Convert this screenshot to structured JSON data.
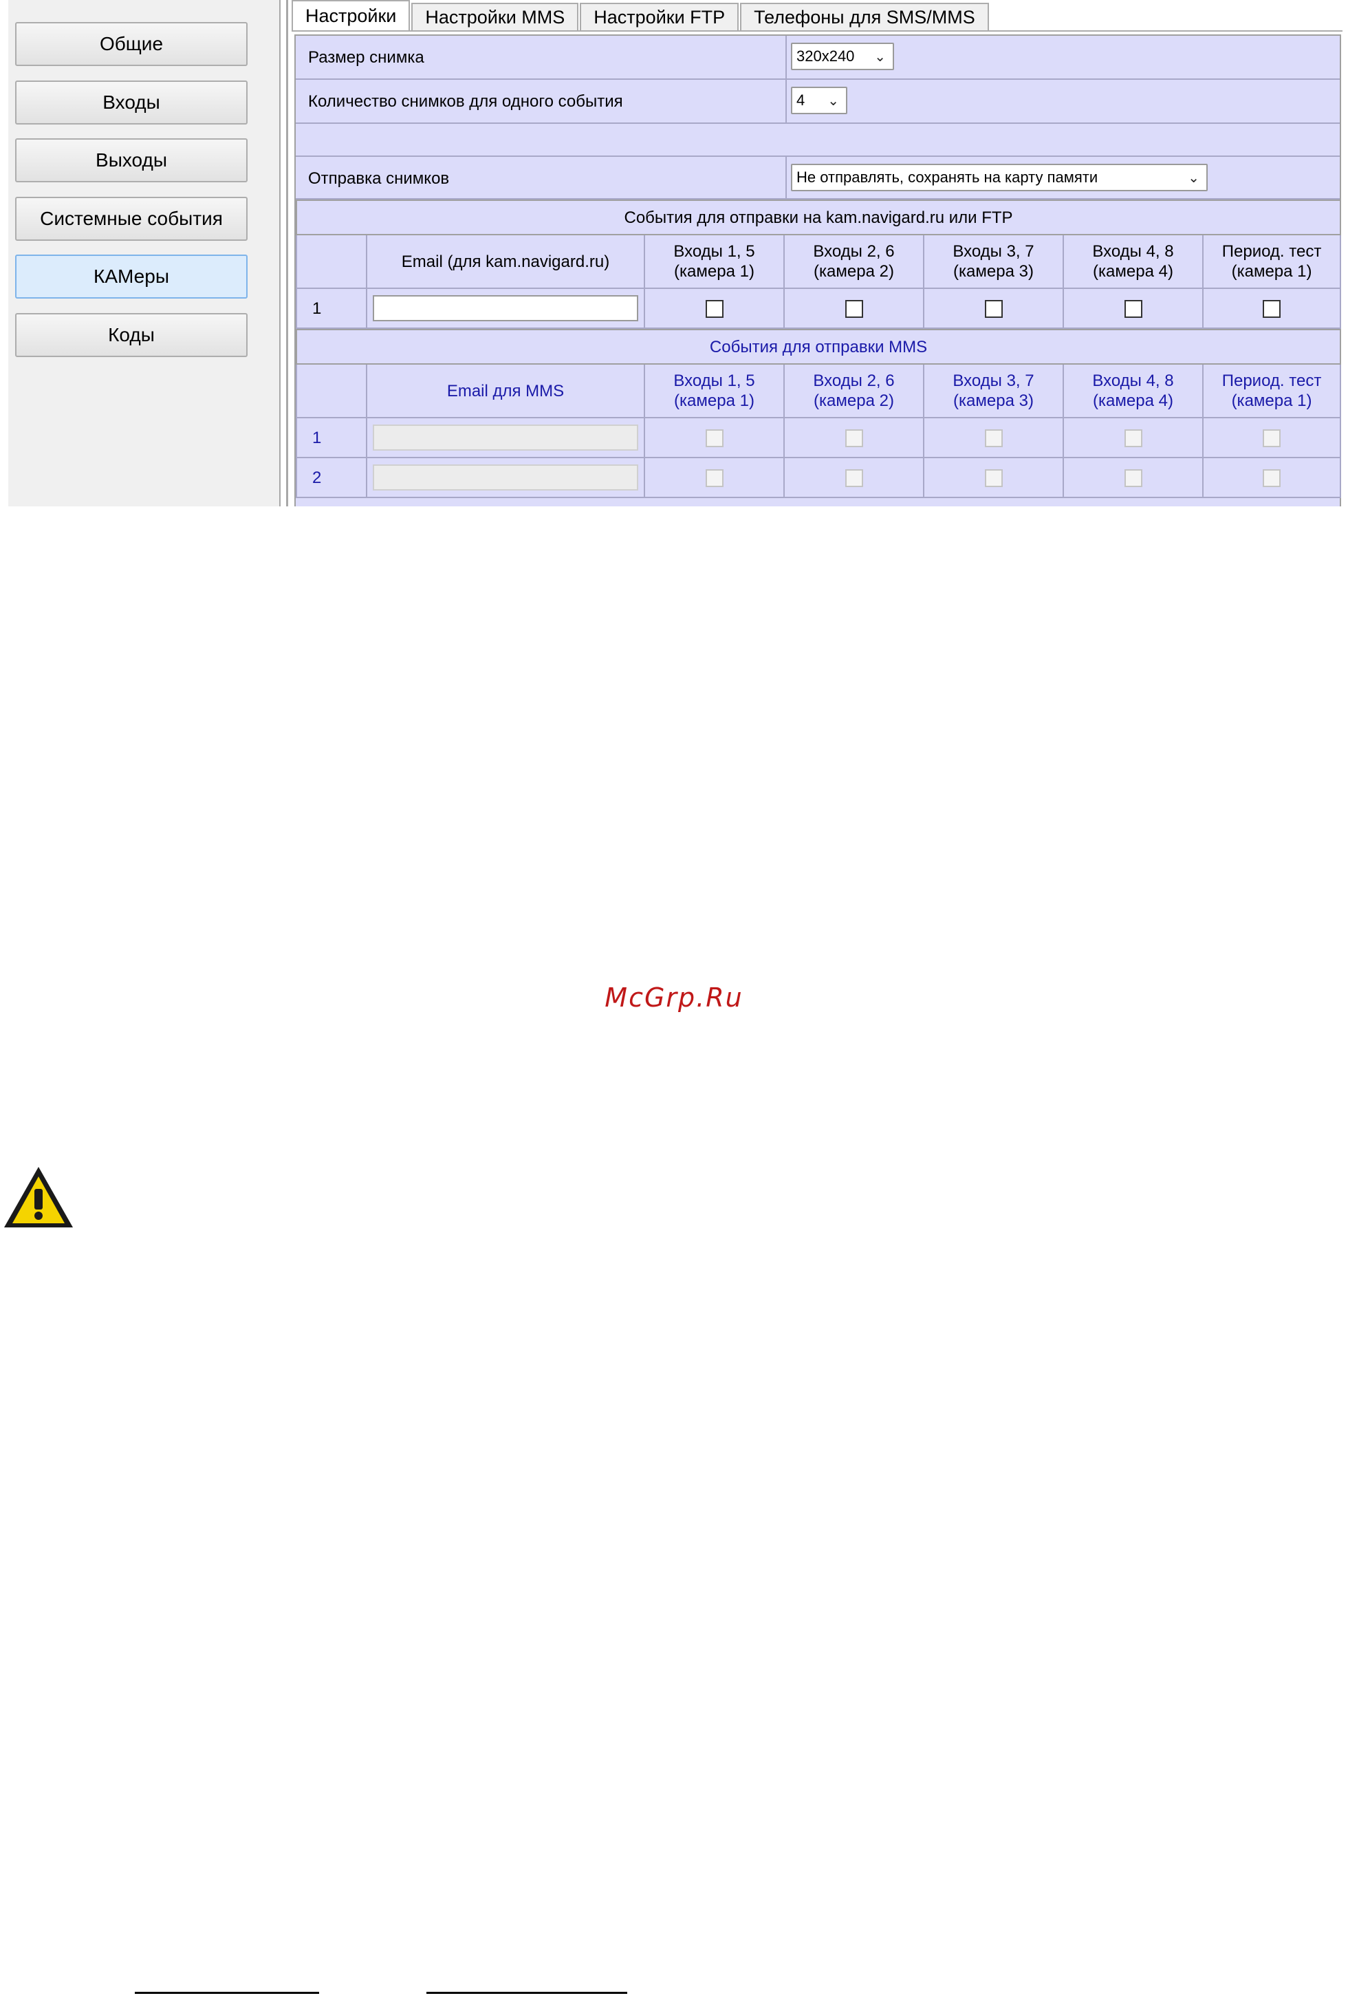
{
  "sidebar": {
    "items": [
      {
        "label": "Общие"
      },
      {
        "label": "Входы"
      },
      {
        "label": "Выходы"
      },
      {
        "label": "Системные события"
      },
      {
        "label": "КАМеры"
      },
      {
        "label": "Коды"
      }
    ],
    "selected": "КАМеры"
  },
  "tabs": [
    {
      "label": "Настройки"
    },
    {
      "label": "Настройки MMS"
    },
    {
      "label": "Настройки FTP"
    },
    {
      "label": "Телефоны для SMS/MMS"
    }
  ],
  "settings": {
    "photo_size": {
      "label": "Размер снимка",
      "value": "320x240"
    },
    "photo_count": {
      "label": "Количество снимков для одного события",
      "value": "4"
    },
    "send_photos": {
      "label": "Отправка снимков",
      "value": "Не отправлять, сохранять на карту памяти"
    }
  },
  "email_table": {
    "title": "События для отправки на kam.navigard.ru или FTP",
    "headers": [
      "",
      "Email (для kam.navigard.ru)",
      "Входы 1, 5\n(камера 1)",
      "Входы 2, 6\n(камера 2)",
      "Входы 3, 7\n(камера 3)",
      "Входы 4, 8\n(камера 4)",
      "Период. тест\n(камера 1)"
    ],
    "rows": [
      {
        "num": "1",
        "email": "",
        "checks": [
          false,
          false,
          false,
          false,
          false
        ]
      }
    ]
  },
  "mms_table": {
    "title": "События для отправки MMS",
    "headers": [
      "",
      "Email для MMS",
      "Входы 1, 5\n(камера 1)",
      "Входы 2, 6\n(камера 2)",
      "Входы 3, 7\n(камера 3)",
      "Входы 4, 8\n(камера 4)",
      "Период. тест\n(камера 1)"
    ],
    "rows": [
      {
        "num": "1",
        "email": "",
        "checks": [
          false,
          false,
          false,
          false,
          false
        ]
      },
      {
        "num": "2",
        "email": "",
        "checks": [
          false,
          false,
          false,
          false,
          false
        ]
      }
    ]
  },
  "watermark": "McGrp.Ru",
  "warning_icon": "warning-triangle-icon",
  "colors": {
    "panel_bg": "#dcdcfa",
    "selected_bg": "#dcecfc",
    "mms_text": "#1a1aa8",
    "watermark": "#c01818"
  }
}
